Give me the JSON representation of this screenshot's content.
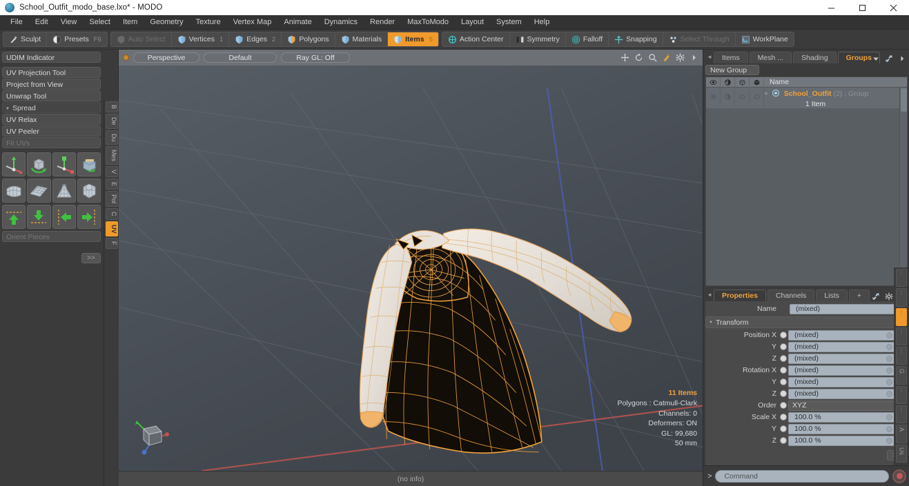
{
  "window": {
    "title": "School_Outfit_modo_base.lxo* - MODO",
    "minimize": "—",
    "maximize": "▢",
    "close": "✕"
  },
  "menu": {
    "items": [
      "File",
      "Edit",
      "View",
      "Select",
      "Item",
      "Geometry",
      "Texture",
      "Vertex Map",
      "Animate",
      "Dynamics",
      "Render",
      "MaxToModo",
      "Layout",
      "System",
      "Help"
    ]
  },
  "toolbar": {
    "group1": [
      {
        "label": "Sculpt",
        "icon": "sculpt-icon",
        "shortcut": "",
        "state": "normal"
      },
      {
        "label": "Presets",
        "icon": "presets-icon",
        "shortcut": "F6",
        "state": "normal"
      }
    ],
    "group2": [
      {
        "label": "Auto Select",
        "icon": "auto-select-icon",
        "shortcut": "",
        "state": "disabled"
      },
      {
        "label": "Vertices",
        "icon": "vertices-icon",
        "shortcut": "1",
        "state": "normal"
      },
      {
        "label": "Edges",
        "icon": "edges-icon",
        "shortcut": "2",
        "state": "normal"
      },
      {
        "label": "Polygons",
        "icon": "polygons-icon",
        "shortcut": "",
        "state": "normal"
      },
      {
        "label": "Materials",
        "icon": "materials-icon",
        "shortcut": "",
        "state": "normal"
      },
      {
        "label": "Items",
        "icon": "items-icon",
        "shortcut": "5",
        "state": "active"
      }
    ],
    "group3": [
      {
        "label": "Action Center",
        "icon": "action-center-icon",
        "state": "normal"
      },
      {
        "label": "Symmetry",
        "icon": "symmetry-icon",
        "state": "normal"
      },
      {
        "label": "Falloff",
        "icon": "falloff-icon",
        "state": "normal"
      },
      {
        "label": "Snapping",
        "icon": "snapping-icon",
        "state": "normal"
      },
      {
        "label": "Select Through",
        "icon": "select-through-icon",
        "state": "disabled"
      },
      {
        "label": "WorkPlane",
        "icon": "workplane-icon",
        "state": "normal"
      }
    ]
  },
  "left_panel": {
    "rows": [
      {
        "label": "UDIM Indicator",
        "state": "normal",
        "type": "button"
      },
      {
        "label": "UV Projection Tool",
        "state": "normal",
        "type": "button"
      },
      {
        "label": "Project from View",
        "state": "normal",
        "type": "button"
      },
      {
        "label": "Unwrap Tool",
        "state": "normal",
        "type": "button"
      },
      {
        "label": "Spread",
        "state": "normal",
        "type": "header"
      },
      {
        "label": "UV Relax",
        "state": "normal",
        "type": "button"
      },
      {
        "label": "UV Peeler",
        "state": "normal",
        "type": "button"
      },
      {
        "label": "Fit UVs",
        "state": "disabled",
        "type": "button"
      }
    ],
    "orient_pieces": "Orient Pieces",
    "more_button": ">>",
    "icon_rows": [
      [
        "move-axis-icon",
        "rotate-cube-icon",
        "scale-axis-icon",
        "transform-box-icon"
      ],
      [
        "shell-mesh-icon",
        "grid-plane-icon",
        "cone-mesh-icon",
        "cube-wire-icon"
      ],
      [
        "arrow-up-icon",
        "arrow-down-icon",
        "arrow-left-icon",
        "arrow-right-icon"
      ]
    ],
    "vertical_tabs": [
      {
        "label": "B",
        "active": false
      },
      {
        "label": "De",
        "active": false
      },
      {
        "label": "Du",
        "active": false
      },
      {
        "label": "Mes",
        "active": false
      },
      {
        "label": "V",
        "active": false
      },
      {
        "label": "E",
        "active": false
      },
      {
        "label": "Pol",
        "active": false
      },
      {
        "label": "C",
        "active": false
      },
      {
        "label": "UV",
        "active": true
      },
      {
        "label": "F",
        "active": false
      }
    ]
  },
  "viewport": {
    "pills": [
      "Perspective",
      "Default",
      "Ray GL: Off"
    ],
    "icons": [
      "pan-icon",
      "rotate-icon",
      "zoom-icon",
      "select-tool-icon",
      "gear-icon",
      "chevron-right-icon"
    ],
    "info": {
      "items": "11 Items",
      "polygons": "Polygons : Catmull-Clark",
      "channels": "Channels: 0",
      "deformers": "Deformers: ON",
      "gl": "GL: 99,680",
      "scale": "50 mm"
    },
    "status": "(no info)"
  },
  "right_panel": {
    "top_tabs": [
      {
        "label": "Items",
        "active": false
      },
      {
        "label": "Mesh ...",
        "active": false
      },
      {
        "label": "Shading",
        "active": false
      },
      {
        "label": "Groups",
        "active": true
      }
    ],
    "new_group_button": "New Group",
    "list": {
      "columns": [
        "eye-icon",
        "lock-icon",
        "box-outline-icon",
        "box-solid-icon"
      ],
      "name_header": "Name",
      "rows": [
        {
          "name": "School_Outfit",
          "meta": "(2) : Group",
          "count": "1 Item",
          "icon": "group-icon"
        }
      ]
    },
    "properties": {
      "tabs": [
        {
          "label": "Properties",
          "active": true
        },
        {
          "label": "Channels",
          "active": false
        },
        {
          "label": "Lists",
          "active": false
        },
        {
          "label": "+",
          "active": false
        }
      ],
      "name_label": "Name",
      "name_value": "(mixed)",
      "section_transform": "Transform",
      "fields": [
        {
          "label": "Position X",
          "value": "(mixed)",
          "type": "numeric"
        },
        {
          "label": "Y",
          "value": "(mixed)",
          "type": "numeric"
        },
        {
          "label": "Z",
          "value": "(mixed)",
          "type": "numeric"
        },
        {
          "label": "Rotation X",
          "value": "(mixed)",
          "type": "numeric"
        },
        {
          "label": "Y",
          "value": "(mixed)",
          "type": "numeric"
        },
        {
          "label": "Z",
          "value": "(mixed)",
          "type": "numeric"
        },
        {
          "label": "Order",
          "value": "XYZ",
          "type": "dropdown"
        },
        {
          "label": "Scale X",
          "value": "100.0 %",
          "type": "numeric"
        },
        {
          "label": "Y",
          "value": "100.0 %",
          "type": "numeric"
        },
        {
          "label": "Z",
          "value": "100.0 %",
          "type": "numeric"
        }
      ],
      "more_button": ">>"
    },
    "side_tabs": [
      {
        "label": "",
        "active": false
      },
      {
        "label": "",
        "active": false
      },
      {
        "label": "",
        "active": true
      },
      {
        "label": "",
        "active": false
      },
      {
        "label": "",
        "active": false
      },
      {
        "label": "G",
        "active": false
      },
      {
        "label": "",
        "active": false
      },
      {
        "label": "",
        "active": false
      },
      {
        "label": "A",
        "active": false
      },
      {
        "label": "Us",
        "active": false
      }
    ]
  },
  "command_bar": {
    "prefix": ">",
    "placeholder": "Command",
    "record_button": "record-icon"
  },
  "colors": {
    "accent": "#f09a2b",
    "panel_bg": "#3b3b3b",
    "field_bg": "#a9b3bd",
    "wire": "#f0a23c"
  }
}
